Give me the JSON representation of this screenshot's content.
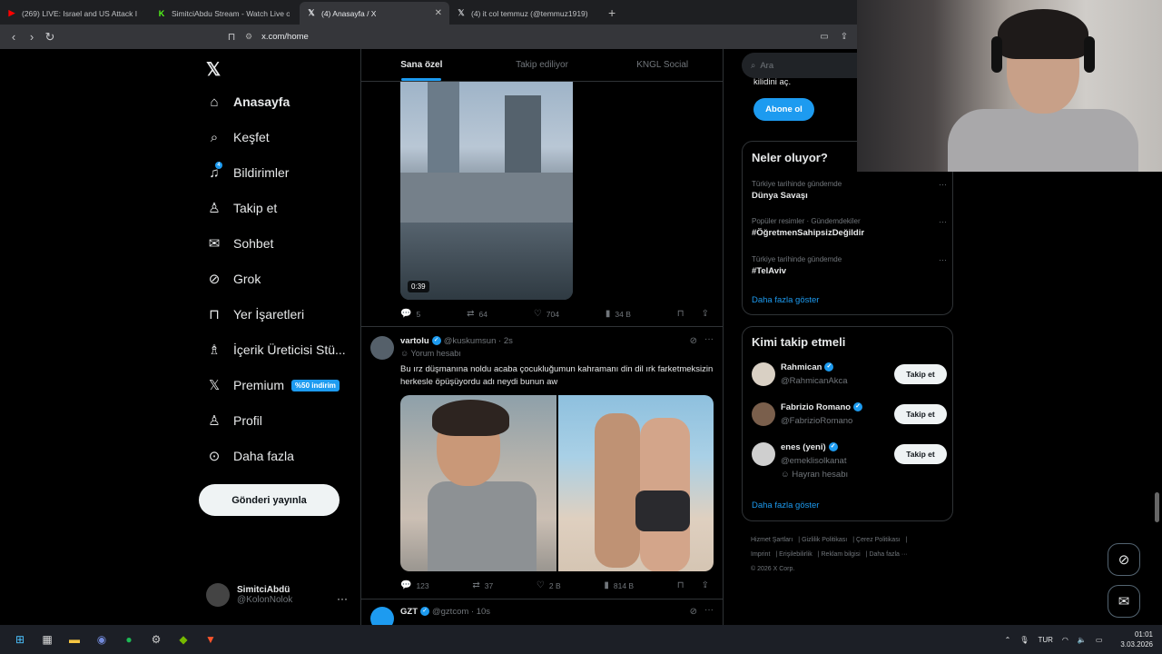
{
  "browser": {
    "tabs": [
      {
        "title": "(269) LIVE: Israel and US Attack I",
        "icon": "youtube-icon",
        "color": "#ff0000",
        "active": false
      },
      {
        "title": "SimitciAbdu Stream - Watch Live on",
        "icon": "kick-icon",
        "color": "#53fc18",
        "active": false
      },
      {
        "title": "(4) Anasayfa / X",
        "icon": "x-icon",
        "color": "#ffffff",
        "active": true
      },
      {
        "title": "(4) it col temmuz (@temmuz1919) / X",
        "icon": "x-icon",
        "color": "#ffffff",
        "active": false
      }
    ],
    "url": "x.com/home"
  },
  "sidebar": {
    "logo": "𝕏",
    "items": [
      {
        "label": "Anasayfa",
        "icon": "home-icon",
        "glyph": "⌂"
      },
      {
        "label": "Keşfet",
        "icon": "search-icon",
        "glyph": "⌕"
      },
      {
        "label": "Bildirimler",
        "icon": "bell-icon",
        "glyph": "🔔",
        "badge": "4"
      },
      {
        "label": "Takip et",
        "icon": "add-user-icon",
        "glyph": "👤"
      },
      {
        "label": "Sohbet",
        "icon": "mail-icon",
        "glyph": "✉"
      },
      {
        "label": "Grok",
        "icon": "grok-icon",
        "glyph": "⊘"
      },
      {
        "label": "Yer İşaretleri",
        "icon": "bookmark-icon",
        "glyph": "🔖"
      },
      {
        "label": "İçerik Üreticisi Stü...",
        "icon": "creator-icon",
        "glyph": "♙"
      },
      {
        "label": "Premium",
        "icon": "x-premium-icon",
        "glyph": "𝕏",
        "tag": "%50 indirim"
      },
      {
        "label": "Profil",
        "icon": "profile-icon",
        "glyph": "♙"
      },
      {
        "label": "Daha fazla",
        "icon": "more-circle-icon",
        "glyph": "⊙"
      }
    ],
    "post_button": "Gönderi yayınla",
    "account": {
      "name": "SimitciAbdü",
      "handle": "@KolonNolok"
    }
  },
  "feed": {
    "tabs": [
      "Sana özel",
      "Takip ediliyor",
      "KNGL Social"
    ],
    "video_duration": "0:39",
    "tweet1_actions": {
      "replies": "5",
      "retweets": "64",
      "likes": "704",
      "views": "34 B"
    },
    "tweet2": {
      "name": "vartolu",
      "handle": "@kuskumsun",
      "time": "2s",
      "sub": "Yorum hesabı",
      "text": "Bu ırz düşmanına noldu acaba çocukluğumun kahramanı din dil ırk farketmeksizin herkesle öpüşüyordu adı neydi bunun aw",
      "replies": "123",
      "retweets": "37",
      "likes": "2 B",
      "views": "814 B"
    },
    "tweet3": {
      "name": "GZT",
      "handle": "@gztcom",
      "time": "10s"
    }
  },
  "right": {
    "search_placeholder": "Ara",
    "sub_text": "kilidini aç.",
    "sub_button": "Abone ol",
    "trends_title": "Neler oluyor?",
    "trends": [
      {
        "meta": "Türkiye tarihinde gündemde",
        "title": "Dünya Savaşı"
      },
      {
        "meta": "Popüler resimler · Gündemdekiler",
        "title": "#ÖğretmenSahipsizDeğildir"
      },
      {
        "meta": "Türkiye tarihinde gündemde",
        "title": "#TelAviv"
      }
    ],
    "show_more": "Daha fazla göster",
    "who_title": "Kimi takip etmeli",
    "who": [
      {
        "name": "Rahmican",
        "handle": "@RahmicanAkca",
        "extra": ""
      },
      {
        "name": "Fabrizio Romano",
        "handle": "@FabrizioRomano",
        "extra": ""
      },
      {
        "name": "enes (yeni)",
        "handle": "@emeklisolkanat",
        "extra": "Hayran hesabı"
      }
    ],
    "follow_label": "Takip et",
    "footer": [
      "Hizmet Şartları",
      "Gizlilik Politikası",
      "Çerez Politikası",
      "Imprint",
      "Erişilebilirlik",
      "Reklam bilgisi",
      "Daha fazla ···",
      "© 2026 X Corp."
    ]
  },
  "taskbar": {
    "lang": "TUR",
    "time": "01:01",
    "date": "3.03.2026"
  }
}
